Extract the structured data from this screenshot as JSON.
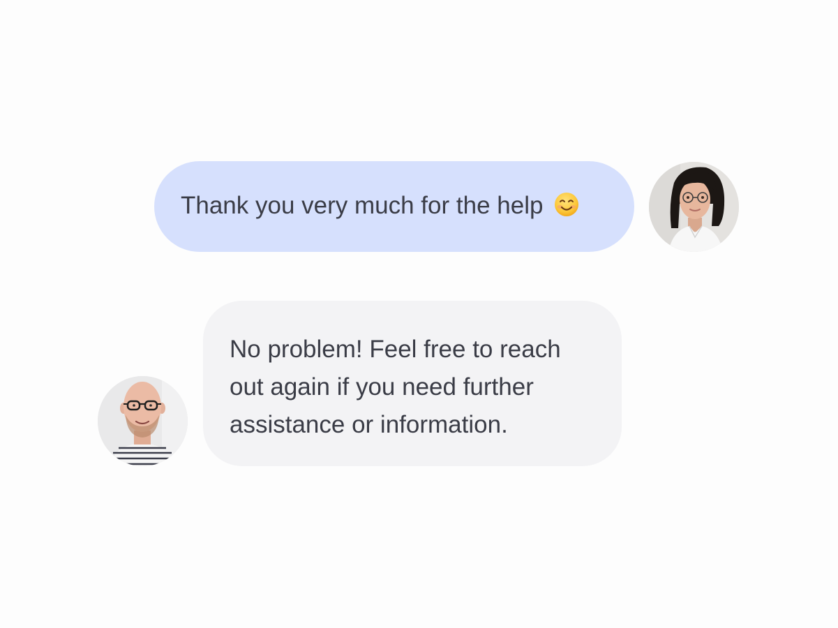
{
  "conversation": {
    "messages": [
      {
        "sender": "user",
        "text": "Thank you very much for the help",
        "emoji_icon": "smiling-face-icon",
        "bubble_color": "#d6e0fd"
      },
      {
        "sender": "agent",
        "text": "No problem! Feel free to reach out again if you need further assistance or information.",
        "bubble_color": "#f3f3f5"
      }
    ],
    "text_color": "#3a3c46",
    "background_color": "#fdfdfd"
  }
}
